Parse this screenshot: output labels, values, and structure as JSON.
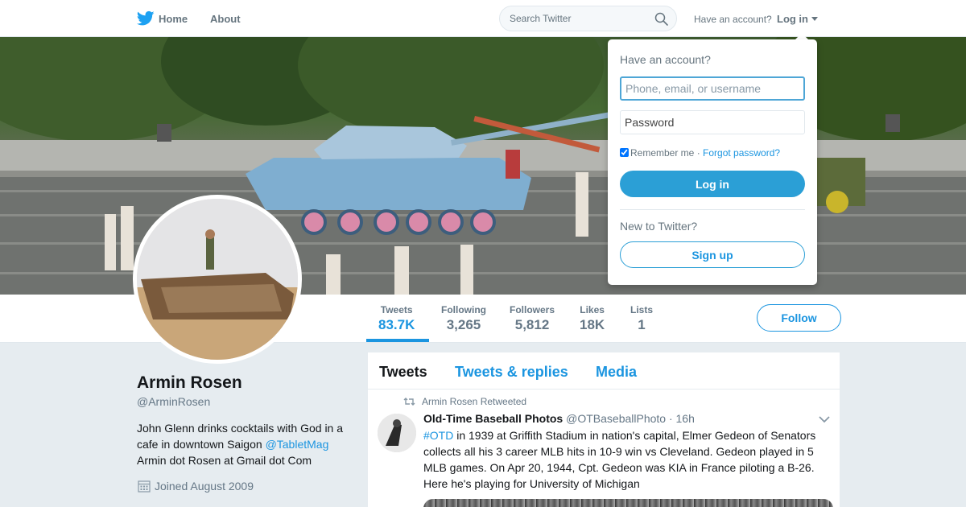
{
  "nav": {
    "logo_icon": "twitter-bird-icon",
    "home_label": "Home",
    "about_label": "About",
    "search_placeholder": "Search Twitter",
    "have_account": "Have an account?",
    "login_label": "Log in"
  },
  "profile": {
    "name": "Armin Rosen",
    "handle": "@ArminRosen",
    "bio_line1": "John Glenn drinks cocktails with God in a cafe in downtown Saigon ",
    "bio_mention": "@TabletMag",
    "bio_line2": "Armin dot Rosen at Gmail dot Com",
    "joined": "Joined August 2009"
  },
  "stats": [
    {
      "label": "Tweets",
      "value": "83.7K"
    },
    {
      "label": "Following",
      "value": "3,265"
    },
    {
      "label": "Followers",
      "value": "5,812"
    },
    {
      "label": "Likes",
      "value": "18K"
    },
    {
      "label": "Lists",
      "value": "1"
    }
  ],
  "follow_label": "Follow",
  "tabs": [
    "Tweets",
    "Tweets & replies",
    "Media"
  ],
  "tweet": {
    "retweet_context": "Armin Rosen Retweeted",
    "author": "Old-Time Baseball Photos",
    "handle": "@OTBaseballPhoto",
    "time": "· 16h",
    "hashtag": "#OTD",
    "text": " in 1939 at Griffith Stadium in nation's capital, Elmer Gedeon of Senators collects all his 3 career MLB hits in 10-9 win vs Cleveland. Gedeon played in 5 MLB games. On Apr 20, 1944, Cpt. Gedeon was KIA in France piloting a B-26. Here he's playing for University of Michigan"
  },
  "login_dropdown": {
    "title": "Have an account?",
    "username_placeholder": "Phone, email, or username",
    "password_placeholder": "Password",
    "remember_label": "Remember me",
    "separator": " · ",
    "forgot_label": "Forgot password?",
    "login_button": "Log in",
    "new_to_twitter": "New to Twitter?",
    "signup_button": "Sign up"
  },
  "colors": {
    "accent": "#1b95e0",
    "button_blue": "#2b9fd6",
    "muted": "#657786",
    "background": "#e6ecf0"
  }
}
